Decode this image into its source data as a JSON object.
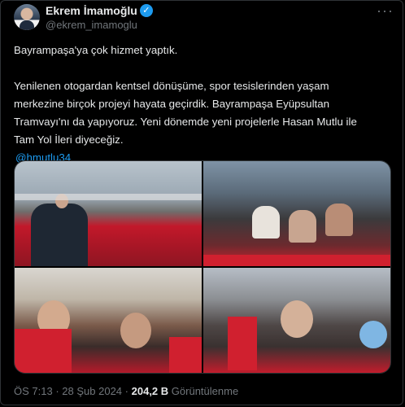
{
  "tweet": {
    "author_name": "Ekrem İmamoğlu",
    "author_handle": "@ekrem_imamoglu",
    "more_label": "···",
    "verified_glyph": "✓",
    "line1": "Bayrampaşa'ya çok hizmet yaptık.",
    "para2_l1": "Yenilenen otogardan kentsel dönüşüme, spor tesislerinden yaşam",
    "para2_l2": "merkezine birçok projeyi hayata geçirdik. Bayrampaşa Eyüpsultan",
    "para2_l3": "Tramvayı'nı da yapıyoruz. Yeni dönemde yeni projelerle Hasan Mutlu ile",
    "para2_l4": "Tam Yol İleri diyeceğiz.",
    "mention": "@hmutlu34"
  },
  "footer": {
    "time": "ÖS 7:13",
    "separator": "·",
    "date": "28 Şub 2024",
    "views_count": "204,2 B",
    "views_label": "Görüntülenme"
  },
  "colors": {
    "accent": "#1d9bf0",
    "background": "#000000",
    "text": "#e7e9ea",
    "muted": "#71767b",
    "flag_red": "#d0202f"
  }
}
